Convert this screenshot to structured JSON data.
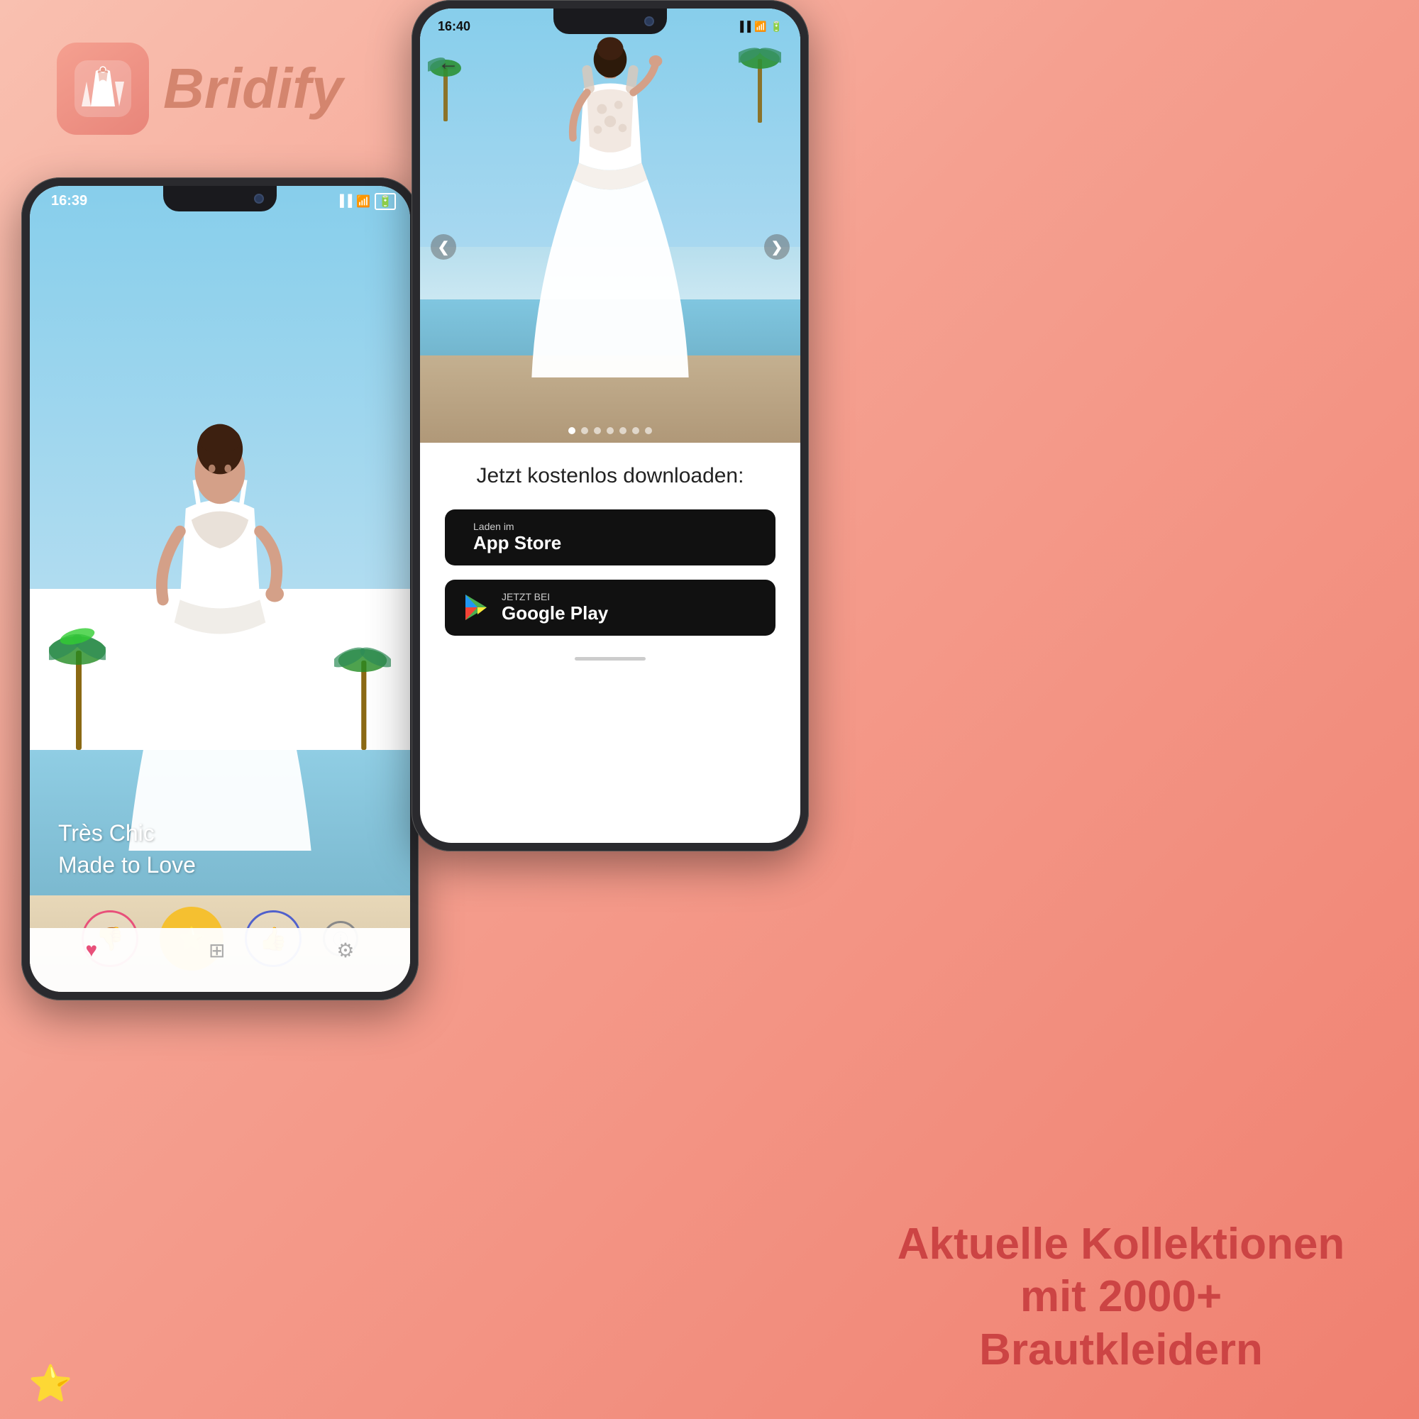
{
  "brand": {
    "name": "Bridify",
    "icon_alt": "bridify-app-icon"
  },
  "phone_left": {
    "time": "16:39",
    "dress_name": "Très Chic",
    "dress_tagline": "Made to Love",
    "buttons": {
      "dislike": "👎",
      "favorite": "⭐",
      "like": "👍",
      "info": "ⓘ"
    },
    "nav": [
      "heart",
      "grid",
      "settings"
    ]
  },
  "phone_right": {
    "time": "16:40",
    "back_arrow": "←",
    "nav_left": "❮",
    "nav_right": "❯",
    "dots_count": 7,
    "active_dot": 0,
    "download_title": "Jetzt kostenlos downloaden:",
    "app_store": {
      "label_small": "Laden im",
      "label_big": "App Store"
    },
    "google_play": {
      "label_small": "JETZT BEI",
      "label_big": "Google Play"
    }
  },
  "footer": {
    "line1": "Aktuelle Kollektionen",
    "line2": "mit 2000+ Brautkleidern"
  },
  "colors": {
    "background_start": "#f9c0b0",
    "background_end": "#f08070",
    "brand_color": "#d4856e",
    "dislike_color": "#e8507a",
    "favorite_color": "#f5c030",
    "like_color": "#5060cc",
    "headline_color": "#cc4444"
  }
}
